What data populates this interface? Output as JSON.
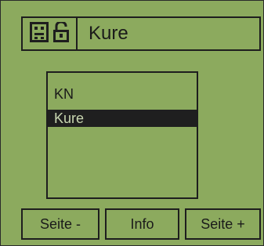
{
  "header": {
    "title": "Kure",
    "icons": [
      "device-icon",
      "unlock-icon"
    ]
  },
  "list": {
    "items": [
      {
        "label": "KN",
        "selected": false
      },
      {
        "label": "Kure",
        "selected": true
      }
    ]
  },
  "buttons": {
    "prev_label": "Seite -",
    "info_label": "Info",
    "next_label": "Seite +"
  },
  "colors": {
    "lcd_background": "#8caa5e",
    "foreground": "#1e1e1e",
    "selection_text": "#c8d6b0"
  }
}
